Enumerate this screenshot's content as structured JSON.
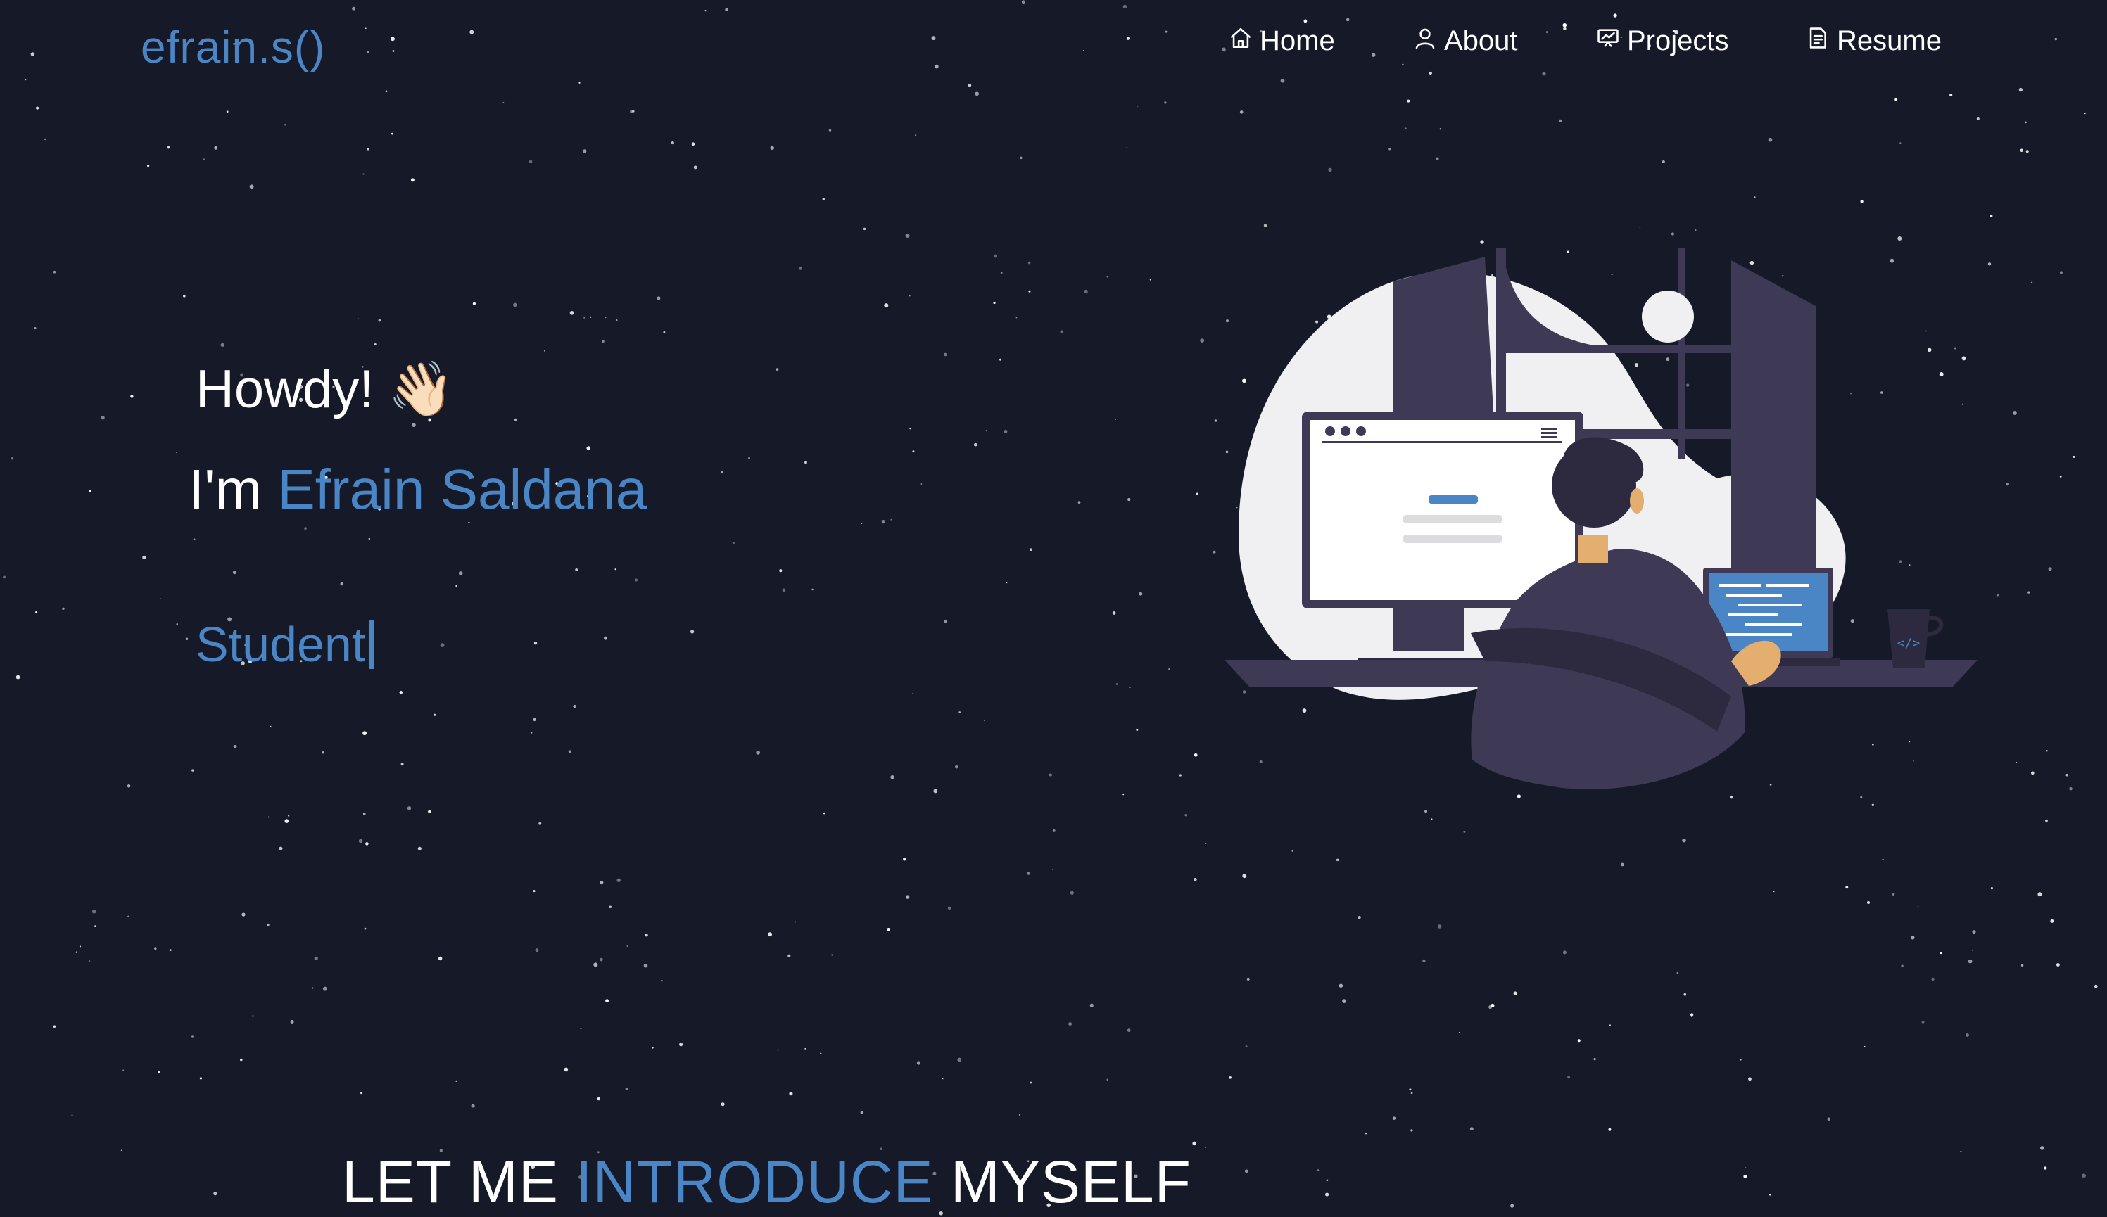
{
  "brand": "efrain.s()",
  "nav": {
    "items": [
      {
        "label": "Home",
        "icon": "home-icon"
      },
      {
        "label": "About",
        "icon": "user-icon"
      },
      {
        "label": "Projects",
        "icon": "presentation-icon"
      },
      {
        "label": "Resume",
        "icon": "document-icon"
      }
    ]
  },
  "hero": {
    "greeting": "Howdy!",
    "wave_emoji": "👋🏻",
    "im_prefix": "I'm",
    "name": "Efrain Saldana",
    "typed_text": "Student"
  },
  "section": {
    "title_part1": "LET ME",
    "title_highlight": "INTRODUCE",
    "title_part2": "MYSELF"
  },
  "colors": {
    "background": "#161a28",
    "accent": "#4a86c5",
    "text": "#ffffff"
  }
}
